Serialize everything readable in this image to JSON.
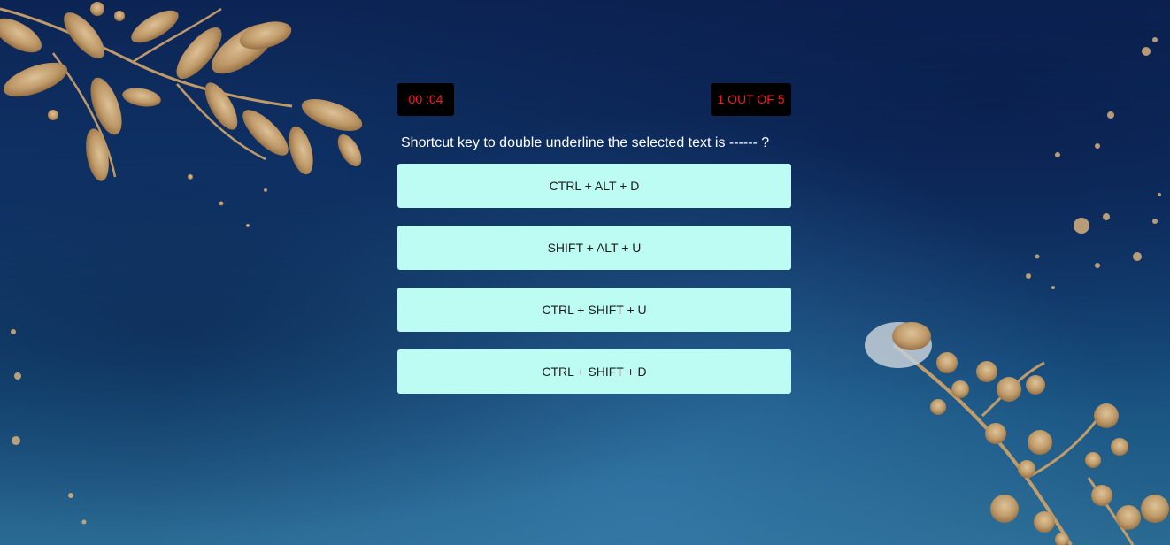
{
  "quiz": {
    "timer": "00 :04",
    "progress": "1 OUT OF 5",
    "question": "Shortcut key to double underline the selected text is ------ ?",
    "options": [
      "CTRL + ALT + D",
      "SHIFT + ALT + U",
      "CTRL + SHIFT + U",
      "CTRL + SHIFT + D"
    ]
  },
  "colors": {
    "badge_background": "#000000",
    "badge_text": "#ff1a1a",
    "option_background": "#bdfcf3",
    "question_text": "#ffffff",
    "background_dark": "#0c2454",
    "background_light": "#2a6b93",
    "leaf_gold": "#c9a06a"
  }
}
